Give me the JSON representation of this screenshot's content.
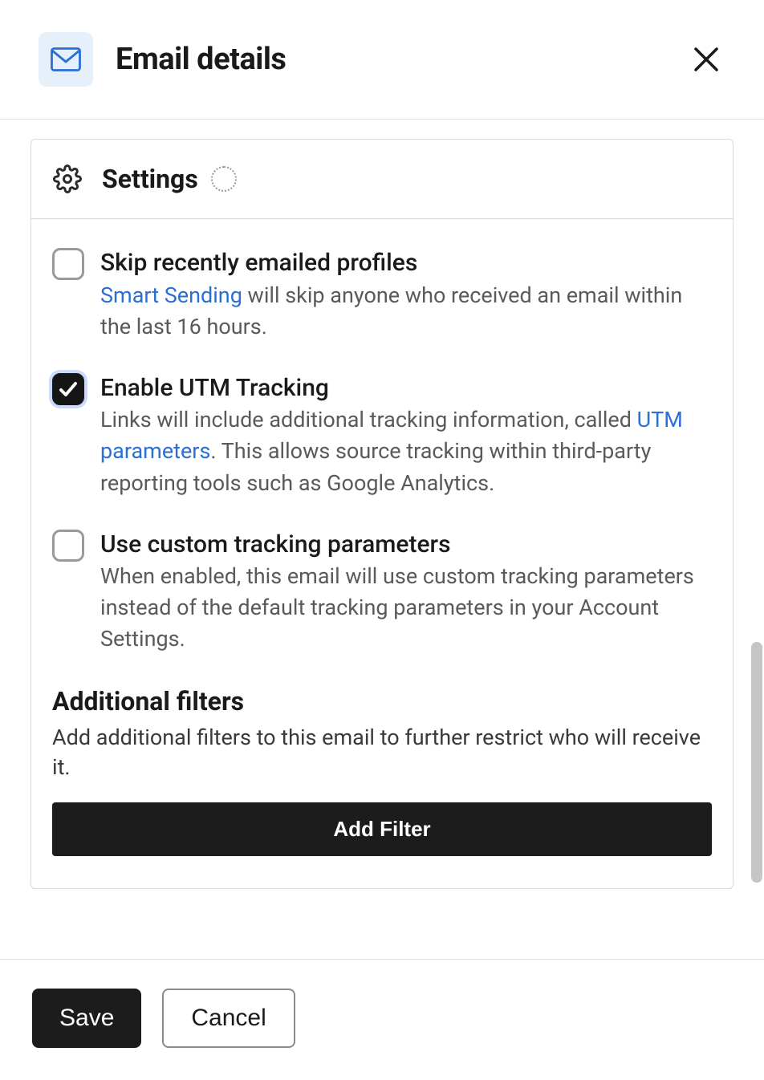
{
  "header": {
    "title": "Email details"
  },
  "settings": {
    "title": "Settings",
    "items": {
      "skip": {
        "label": "Skip recently emailed profiles",
        "link_text": "Smart Sending",
        "desc_after_link": " will skip anyone who received an email within the last 16 hours."
      },
      "utm": {
        "label": "Enable UTM Tracking",
        "desc_before_link": "Links will include additional tracking information, called ",
        "link_text": "UTM parameters",
        "desc_after_link": ". This allows source tracking within third-party reporting tools such as Google Analytics."
      },
      "custom": {
        "label": "Use custom tracking parameters",
        "desc": "When enabled, this email will use custom tracking parameters instead of the default tracking parameters in your Account Settings."
      }
    }
  },
  "filters": {
    "heading": "Additional filters",
    "desc": "Add additional filters to this email to further restrict who will receive it.",
    "button": "Add Filter"
  },
  "footer": {
    "save": "Save",
    "cancel": "Cancel"
  }
}
